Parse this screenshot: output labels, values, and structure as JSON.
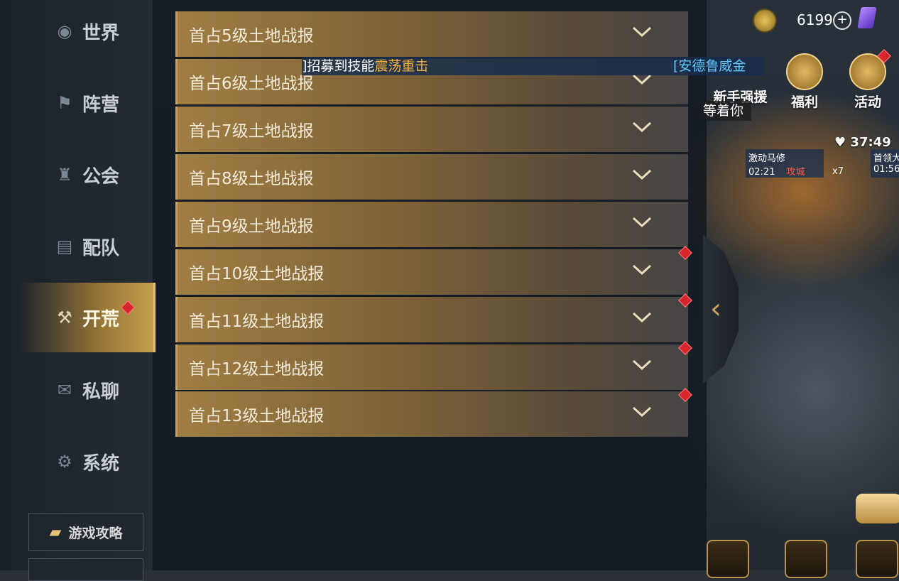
{
  "sidebar": {
    "items": [
      {
        "label": "世界",
        "icon": "globe-icon"
      },
      {
        "label": "阵营",
        "icon": "banner-icon"
      },
      {
        "label": "公会",
        "icon": "guild-crest-icon"
      },
      {
        "label": "配队",
        "icon": "cards-icon"
      },
      {
        "label": "开荒",
        "icon": "plow-icon",
        "active": true
      },
      {
        "label": "私聊",
        "icon": "chat-bubble-icon"
      },
      {
        "label": "系统",
        "icon": "gear-icon"
      }
    ],
    "guide_label": "游戏攻略"
  },
  "reports": [
    {
      "label": "首占5级土地战报",
      "badge": false
    },
    {
      "label": "首占6级土地战报",
      "badge": false
    },
    {
      "label": "首占7级土地战报",
      "badge": false
    },
    {
      "label": "首占8级土地战报",
      "badge": false
    },
    {
      "label": "首占9级土地战报",
      "badge": false
    },
    {
      "label": "首占10级土地战报",
      "badge": true
    },
    {
      "label": "首占11级土地战报",
      "badge": true
    },
    {
      "label": "首占12级土地战报",
      "badge": true
    },
    {
      "label": "首占13级土地战报",
      "badge": true
    }
  ],
  "broadcast": {
    "prefix": "]招募到技能",
    "skill": "震荡重击",
    "player": "[安德鲁威金"
  },
  "resources": {
    "gem_count": "6199",
    "plus": "+"
  },
  "events": {
    "newbie_label": "新手强援",
    "welfare_label": "福利",
    "activity_label": "活动",
    "newbie_tip": "等着你"
  },
  "map": {
    "timer": "37:49",
    "army1_name": "激动马修",
    "army1_time": "02:21",
    "army1_action": "攻城",
    "army2_name": "首领大",
    "army2_time": "01:56",
    "troop_count": "x7"
  },
  "colors": {
    "accent_gold": "#c9a45c",
    "badge_red": "#d7262b",
    "broadcast_highlight": "#f5b342",
    "broadcast_player": "#5ec8ff"
  }
}
